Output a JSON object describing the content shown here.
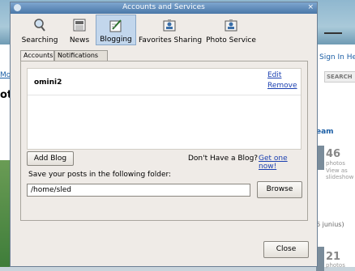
{
  "background": {
    "left_link": "Mor",
    "left_heading": "ot",
    "signin": "Sign In  He",
    "search": "SEARCH",
    "team": "eam",
    "count1": "46",
    "unit1": "photos",
    "view1": "View as slideshow",
    "junius": "6 junius)",
    "count2": "21",
    "unit2": "photos"
  },
  "dialog": {
    "title": "Accounts and Services",
    "close": "×"
  },
  "toolbar": {
    "items": [
      {
        "label": "Searching"
      },
      {
        "label": "News"
      },
      {
        "label": "Blogging"
      },
      {
        "label": "Favorites Sharing"
      },
      {
        "label": "Photo Service"
      }
    ],
    "active": "Blogging"
  },
  "tabs": {
    "accounts": "Accounts",
    "notifications": "Notifications"
  },
  "accounts": {
    "rows": [
      {
        "name": "omini2",
        "edit": "Edit",
        "remove": "Remove"
      }
    ]
  },
  "add_blog": "Add Blog",
  "no_blog_text": "Don't Have a Blog?",
  "get_one": "Get one now!",
  "folder_label": "Save your posts in the following folder:",
  "folder_value": "/home/sled",
  "browse": "Browse",
  "close_button": "Close",
  "colors": {
    "accent": "#4a77a8",
    "link": "#1a3fb0",
    "active_tab": "#c2d6ec"
  }
}
